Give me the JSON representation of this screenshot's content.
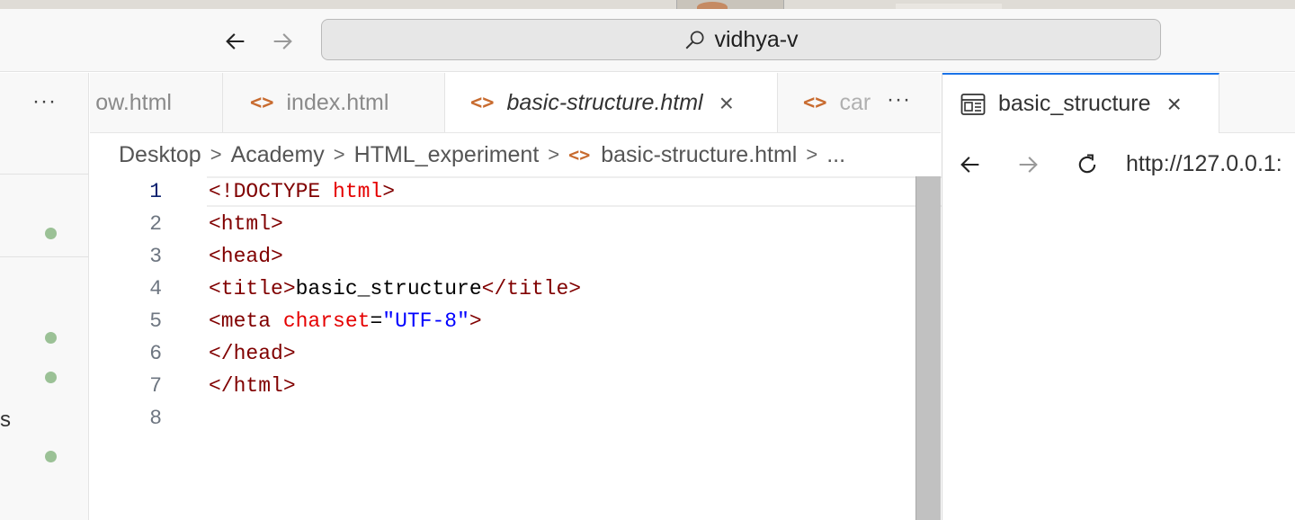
{
  "titlebar": {
    "search_text": "vidhya-v",
    "back_icon": "arrow-left-icon",
    "forward_icon": "arrow-right-icon",
    "search_icon": "search-icon"
  },
  "sidebar": {
    "more_label": "···",
    "partial_label": "s"
  },
  "tabs": [
    {
      "label": "ow.html",
      "icon": "code-file-icon",
      "icon_glyph": "",
      "active": false
    },
    {
      "label": "index.html",
      "icon": "code-file-icon",
      "icon_glyph": "<>",
      "active": false
    },
    {
      "label": "basic-structure.html",
      "icon": "code-file-icon",
      "icon_glyph": "<>",
      "active": true,
      "close": "×"
    },
    {
      "label": "car",
      "icon": "code-file-icon",
      "icon_glyph": "<>",
      "active": false
    }
  ],
  "tab_more_label": "···",
  "breadcrumb": {
    "items": [
      "Desktop",
      "Academy",
      "HTML_experiment",
      "basic-structure.html",
      "..."
    ],
    "separator": ">",
    "file_icon_glyph": "<>"
  },
  "editor": {
    "current_line": 1,
    "lines": [
      {
        "num": "1",
        "tokens": [
          {
            "t": "tag",
            "v": "<!DOCTYPE "
          },
          {
            "t": "attr",
            "v": "html"
          },
          {
            "t": "tag",
            "v": ">"
          }
        ]
      },
      {
        "num": "2",
        "tokens": [
          {
            "t": "tag",
            "v": "<html>"
          }
        ]
      },
      {
        "num": "3",
        "tokens": [
          {
            "t": "tag",
            "v": "<head>"
          }
        ]
      },
      {
        "num": "4",
        "tokens": [
          {
            "t": "tag",
            "v": "<title>"
          },
          {
            "t": "text",
            "v": "basic_structure"
          },
          {
            "t": "tag",
            "v": "</title>"
          }
        ]
      },
      {
        "num": "5",
        "tokens": [
          {
            "t": "tag",
            "v": "<meta "
          },
          {
            "t": "attr",
            "v": "charset"
          },
          {
            "t": "text",
            "v": "="
          },
          {
            "t": "str",
            "v": "\"UTF-8\""
          },
          {
            "t": "tag",
            "v": ">"
          }
        ]
      },
      {
        "num": "6",
        "tokens": [
          {
            "t": "tag",
            "v": "</head>"
          }
        ]
      },
      {
        "num": "7",
        "tokens": [
          {
            "t": "tag",
            "v": "</html>"
          }
        ]
      },
      {
        "num": "8",
        "tokens": []
      }
    ]
  },
  "preview": {
    "tab_label": "basic_structure",
    "tab_close": "×",
    "tab_icon": "browser-preview-icon",
    "url": "http://127.0.0.1:",
    "back_icon": "arrow-left-icon",
    "forward_icon": "arrow-right-icon",
    "reload_icon": "reload-icon"
  },
  "colors": {
    "accent": "#1a73e8",
    "html_tag": "#800000",
    "html_attr": "#e50000",
    "html_string": "#0000ff",
    "file_icon": "#c86b2f",
    "git_dot": "#9bc196"
  }
}
